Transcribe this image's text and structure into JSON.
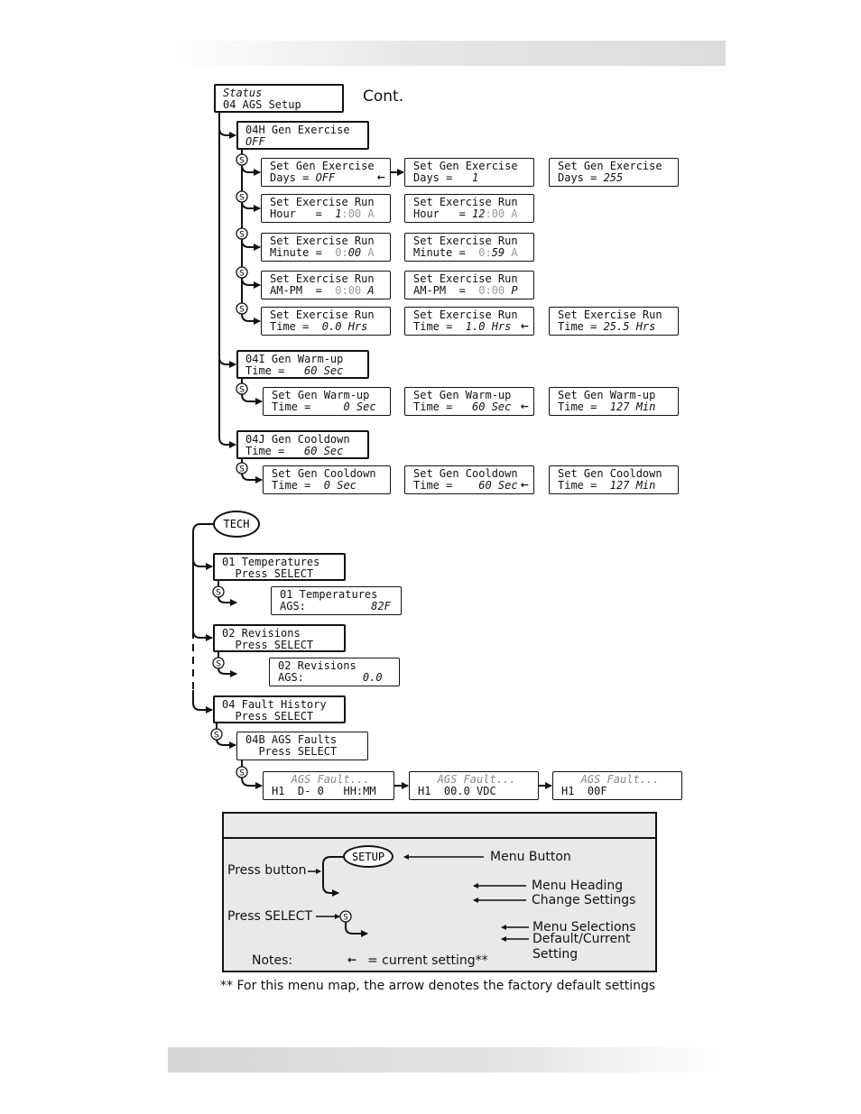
{
  "cont_label": "Cont.",
  "boxes": {
    "status": {
      "l1": [
        {
          "t": "Status",
          "s": "i"
        }
      ],
      "l2": [
        {
          "t": "04 AGS Setup",
          "s": ""
        }
      ]
    },
    "h04h": {
      "l1": [
        {
          "t": "04H Gen Exercise",
          "s": ""
        }
      ],
      "l2": [
        {
          "t": "OFF",
          "s": "i"
        }
      ]
    },
    "days_off": {
      "l1": [
        {
          "t": "Set Gen Exercise",
          "s": ""
        }
      ],
      "l2": [
        {
          "t": "Days = ",
          "s": ""
        },
        {
          "t": "OFF",
          "s": "i"
        }
      ],
      "current": true
    },
    "days_1": {
      "l1": [
        {
          "t": "Set Gen Exercise",
          "s": ""
        }
      ],
      "l2": [
        {
          "t": "Days =   ",
          "s": ""
        },
        {
          "t": "1",
          "s": "i"
        }
      ]
    },
    "days_255": {
      "l1": [
        {
          "t": "Set Gen Exercise",
          "s": ""
        }
      ],
      "l2": [
        {
          "t": "Days = ",
          "s": ""
        },
        {
          "t": "255",
          "s": "i"
        }
      ]
    },
    "hour_1": {
      "l1": [
        {
          "t": "Set Exercise Run",
          "s": ""
        }
      ],
      "l2": [
        {
          "t": "Hour   =  ",
          "s": ""
        },
        {
          "t": "1",
          "s": "i"
        },
        {
          "t": ":00 A",
          "s": "g"
        }
      ]
    },
    "hour_12": {
      "l1": [
        {
          "t": "Set Exercise Run",
          "s": ""
        }
      ],
      "l2": [
        {
          "t": "Hour   = ",
          "s": ""
        },
        {
          "t": "12",
          "s": "i"
        },
        {
          "t": ":00 A",
          "s": "g"
        }
      ]
    },
    "min_0": {
      "l1": [
        {
          "t": "Set Exercise Run",
          "s": ""
        }
      ],
      "l2": [
        {
          "t": "Minute =  ",
          "s": ""
        },
        {
          "t": "0:",
          "s": "g"
        },
        {
          "t": "00",
          "s": "i"
        },
        {
          "t": " A",
          "s": "g"
        }
      ]
    },
    "min_59": {
      "l1": [
        {
          "t": "Set Exercise Run",
          "s": ""
        }
      ],
      "l2": [
        {
          "t": "Minute =  ",
          "s": ""
        },
        {
          "t": "0:",
          "s": "g"
        },
        {
          "t": "59",
          "s": "i"
        },
        {
          "t": " A",
          "s": "g"
        }
      ]
    },
    "ampm_a": {
      "l1": [
        {
          "t": "Set Exercise Run",
          "s": ""
        }
      ],
      "l2": [
        {
          "t": "AM-PM  =  ",
          "s": ""
        },
        {
          "t": "0:00 ",
          "s": "g"
        },
        {
          "t": "A",
          "s": "i"
        }
      ]
    },
    "ampm_p": {
      "l1": [
        {
          "t": "Set Exercise Run",
          "s": ""
        }
      ],
      "l2": [
        {
          "t": "AM-PM  =  ",
          "s": ""
        },
        {
          "t": "0:00 ",
          "s": "g"
        },
        {
          "t": "P",
          "s": "i"
        }
      ]
    },
    "time_0": {
      "l1": [
        {
          "t": "Set Exercise Run",
          "s": ""
        }
      ],
      "l2": [
        {
          "t": "Time =  ",
          "s": ""
        },
        {
          "t": "0.0 Hrs",
          "s": "i"
        }
      ]
    },
    "time_1": {
      "l1": [
        {
          "t": "Set Exercise Run",
          "s": ""
        }
      ],
      "l2": [
        {
          "t": "Time =  ",
          "s": ""
        },
        {
          "t": "1.0 Hrs",
          "s": "i"
        }
      ],
      "current": true
    },
    "time_25": {
      "l1": [
        {
          "t": "Set Exercise Run",
          "s": ""
        }
      ],
      "l2": [
        {
          "t": "Time = ",
          "s": ""
        },
        {
          "t": "25.5 Hrs",
          "s": "i"
        }
      ]
    },
    "h04i": {
      "l1": [
        {
          "t": "04I Gen Warm-up",
          "s": ""
        }
      ],
      "l2": [
        {
          "t": "Time =   ",
          "s": ""
        },
        {
          "t": "60 Sec",
          "s": "i"
        }
      ]
    },
    "warm_0": {
      "l1": [
        {
          "t": "Set Gen Warm-up",
          "s": ""
        }
      ],
      "l2": [
        {
          "t": "Time =     ",
          "s": ""
        },
        {
          "t": "0 Sec",
          "s": "i"
        }
      ]
    },
    "warm_60": {
      "l1": [
        {
          "t": "Set Gen Warm-up",
          "s": ""
        }
      ],
      "l2": [
        {
          "t": "Time =   ",
          "s": ""
        },
        {
          "t": "60 Sec",
          "s": "i"
        }
      ],
      "current": true
    },
    "warm_127": {
      "l1": [
        {
          "t": "Set Gen Warm-up",
          "s": ""
        }
      ],
      "l2": [
        {
          "t": "Time =  ",
          "s": ""
        },
        {
          "t": "127 Min",
          "s": "i"
        }
      ]
    },
    "h04j": {
      "l1": [
        {
          "t": "04J Gen Cooldown",
          "s": ""
        }
      ],
      "l2": [
        {
          "t": "Time =   ",
          "s": ""
        },
        {
          "t": "60 Sec",
          "s": "i"
        }
      ]
    },
    "cool_0": {
      "l1": [
        {
          "t": "Set Gen Cooldown",
          "s": ""
        }
      ],
      "l2": [
        {
          "t": "Time =  ",
          "s": ""
        },
        {
          "t": "0 Sec",
          "s": "i"
        }
      ]
    },
    "cool_60": {
      "l1": [
        {
          "t": "Set Gen Cooldown",
          "s": ""
        }
      ],
      "l2": [
        {
          "t": "Time =    ",
          "s": ""
        },
        {
          "t": "60 Sec",
          "s": "i"
        }
      ],
      "current": true
    },
    "cool_127": {
      "l1": [
        {
          "t": "Set Gen Cooldown",
          "s": ""
        }
      ],
      "l2": [
        {
          "t": "Time =  ",
          "s": ""
        },
        {
          "t": "127 Min",
          "s": "i"
        }
      ]
    },
    "temps": {
      "l1": [
        {
          "t": "01 Temperatures",
          "s": ""
        }
      ],
      "l2": [
        {
          "t": "  Press SELECT",
          "s": ""
        }
      ]
    },
    "temps_sub": {
      "l1": [
        {
          "t": "01 Temperatures",
          "s": ""
        }
      ],
      "l2": [
        {
          "t": "AGS:          ",
          "s": ""
        },
        {
          "t": "82F",
          "s": "i"
        }
      ]
    },
    "rev": {
      "l1": [
        {
          "t": "02 Revisions",
          "s": ""
        }
      ],
      "l2": [
        {
          "t": "  Press SELECT",
          "s": ""
        }
      ]
    },
    "rev_sub": {
      "l1": [
        {
          "t": "02 Revisions",
          "s": ""
        }
      ],
      "l2": [
        {
          "t": "AGS:         ",
          "s": ""
        },
        {
          "t": "0.0",
          "s": "i"
        }
      ]
    },
    "fault": {
      "l1": [
        {
          "t": "04 Fault History",
          "s": ""
        }
      ],
      "l2": [
        {
          "t": "  Press SELECT",
          "s": ""
        }
      ]
    },
    "ags_faults": {
      "l1": [
        {
          "t": "04B AGS Faults",
          "s": ""
        }
      ],
      "l2": [
        {
          "t": "  Press SELECT",
          "s": ""
        }
      ]
    },
    "fault_1": {
      "l1": [
        {
          "t": "   AGS Fault...",
          "s": "gi"
        }
      ],
      "l2": [
        {
          "t": "H1  D- 0   HH:MM",
          "s": ""
        }
      ]
    },
    "fault_2": {
      "l1": [
        {
          "t": "   AGS Fault...",
          "s": "gi"
        }
      ],
      "l2": [
        {
          "t": "H1  00.0 VDC",
          "s": ""
        }
      ]
    },
    "fault_3": {
      "l1": [
        {
          "t": "   AGS Fault...",
          "s": "gi"
        }
      ],
      "l2": [
        {
          "t": "H1  00F",
          "s": ""
        }
      ]
    },
    "lg_heading": {
      "l1": [
        {
          "t": "04H Gen Exercise",
          "s": ""
        }
      ],
      "l2": [
        {
          "t": "OFF",
          "s": "i"
        }
      ]
    },
    "lg_select": {
      "l1": [
        {
          "t": "Set Gen Exercise",
          "s": ""
        }
      ],
      "l2": [
        {
          "t": "Days = ",
          "s": ""
        },
        {
          "t": "OFF",
          "s": "i"
        }
      ],
      "current": true
    }
  },
  "tech_button": "TECH",
  "select_symbol": "S",
  "current_arrow": "←",
  "legend": {
    "setup_button": "SETUP",
    "press_button": "Press button",
    "press_select": "Press SELECT",
    "menu_button": "Menu Button",
    "menu_heading": "Menu Heading",
    "change_settings": "Change Settings",
    "menu_selections": "Menu Selections",
    "default_current": "Default/Current",
    "setting": "Setting",
    "notes": "Notes:",
    "current_setting": "= current setting**"
  },
  "footnote": "** For this menu map, the arrow denotes the factory default settings"
}
